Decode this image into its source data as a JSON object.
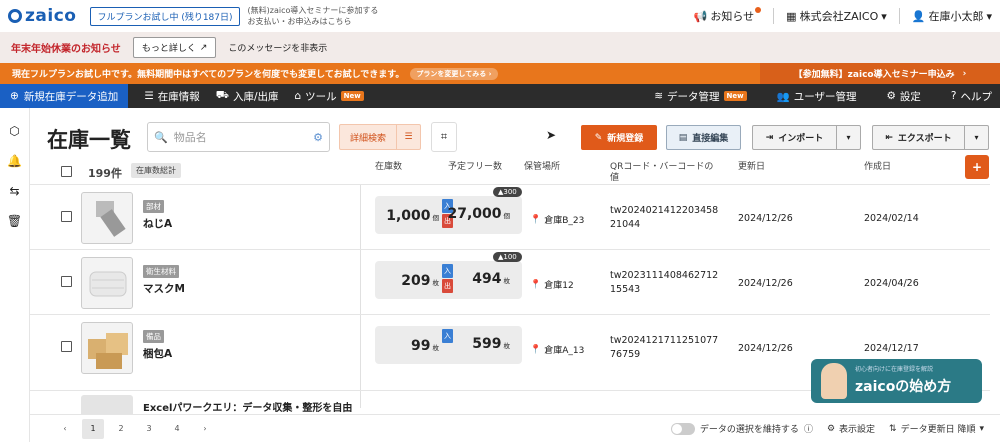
{
  "topbar": {
    "logo": "zaico",
    "trial": "フルプランお試し中 (残り187日)",
    "seminar_line1": "(無料)zaico導入セミナーに参加する",
    "seminar_line2": "お支払い・お申込みはこちら",
    "notice_label": "お知らせ",
    "company": "株式会社ZAICO",
    "user": "在庫小太郎"
  },
  "notice": {
    "text": "年末年始休業のお知らせ",
    "more": "もっと詳しく",
    "hide": "このメッセージを非表示"
  },
  "banner": {
    "text": "現在フルプランお試し中です。無料期間中はすべてのプランを何度でも変更してお試しできます。",
    "plan_btn": "プランを変更してみる",
    "right": "【参加無料】zaico導入セミナー申込み"
  },
  "nav": {
    "add": "新規在庫データ追加",
    "stock": "在庫情報",
    "io": "入庫/出庫",
    "tools": "ツール",
    "new": "New",
    "data": "データ管理",
    "users": "ユーザー管理",
    "settings": "設定",
    "help": "ヘルプ"
  },
  "toolbar": {
    "title": "在庫一覧",
    "search_placeholder": "物品名",
    "detail": "詳細検索",
    "register": "新規登録",
    "direct_edit": "直接編集",
    "import": "インポート",
    "export": "エクスポート"
  },
  "table": {
    "count": "199件",
    "total": "在庫数総計",
    "headers": {
      "stock": "在庫数",
      "free": "予定フリー数",
      "location": "保管場所",
      "qr": "QRコード・バーコードの値",
      "updated": "更新日",
      "created": "作成日"
    }
  },
  "io_labels": {
    "in": "入",
    "out": "出"
  },
  "rows": [
    {
      "category": "部材",
      "name": "ねじA",
      "stock": "1,000",
      "stock_unit": "個",
      "free": "27,000",
      "free_unit": "個",
      "badge": "300",
      "location": "倉庫B_23",
      "qr": "tw2024021412203458 21044",
      "updated": "2024/12/26",
      "created": "2024/02/14"
    },
    {
      "category": "衛生材料",
      "name": "マスクM",
      "stock": "209",
      "stock_unit": "枚",
      "free": "494",
      "free_unit": "枚",
      "badge": "100",
      "location": "倉庫12",
      "qr": "tw2023111408462712 15543",
      "updated": "2024/12/26",
      "created": "2024/04/26"
    },
    {
      "category": "備品",
      "name": "梱包A",
      "stock": "99",
      "stock_unit": "枚",
      "free": "599",
      "free_unit": "枚",
      "badge": "",
      "location": "倉庫A_13",
      "qr": "tw2024121711251077 76759",
      "updated": "2024/12/26",
      "created": "2024/12/17"
    }
  ],
  "partial_row": {
    "name": "Excelパワークエリ：データ収集・整形を自由"
  },
  "pagination": {
    "pages": [
      "1",
      "2",
      "3",
      "4"
    ],
    "current": "1"
  },
  "footer": {
    "keep_selection": "データの選択を維持する",
    "display_settings": "表示設定",
    "sort": "データ更新日 降順"
  },
  "guide": {
    "small": "初心者向けに在庫登録を解説",
    "main": "zaicoの始め方"
  },
  "colors": {
    "accent": "#e05a1a",
    "brand": "#1a60c4",
    "nav": "#2c2c2c"
  }
}
